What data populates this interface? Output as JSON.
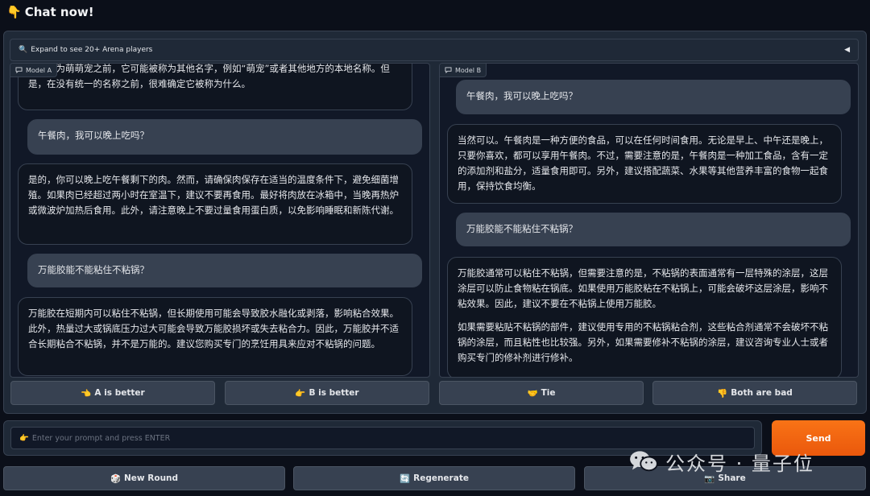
{
  "header": {
    "title": "Chat now!",
    "title_icon": "👇"
  },
  "accordion": {
    "label": "Expand to see 20+ Arena players",
    "icon": "🔍",
    "arrow": "◀"
  },
  "model_a": {
    "label": "Model A",
    "messages": [
      {
        "role": "bot",
        "text": "被命名为萌萌宠之前，它可能被称为其他名字，例如“萌宠”或者其他地方的本地名称。但是，在没有统一的名称之前，很难确定它被称为什么。"
      },
      {
        "role": "user",
        "text": "午餐肉，我可以晚上吃吗？"
      },
      {
        "role": "bot",
        "text": "是的，你可以晚上吃午餐剩下的肉。然而，请确保肉保存在适当的温度条件下，避免细菌增殖。如果肉已经超过两小时在室温下，建议不要再食用。最好将肉放在冰箱中，当晚再热炉或微波炉加热后食用。此外，请注意晚上不要过量食用蛋白质，以免影响睡眠和新陈代谢。"
      },
      {
        "role": "user",
        "text": "万能胶能不能粘住不粘锅？"
      },
      {
        "role": "bot",
        "text": "万能胶在短期内可以粘住不粘锅，但长期使用可能会导致胶水融化或剥落，影响粘合效果。此外，热量过大或锅底压力过大可能会导致万能胶损坏或失去粘合力。因此，万能胶并不适合长期粘合不粘锅，并不是万能的。建议您购买专门的烹饪用具来应对不粘锅的问题。"
      }
    ]
  },
  "model_b": {
    "label": "Model B",
    "messages": [
      {
        "role": "user",
        "text": "午餐肉，我可以晚上吃吗？"
      },
      {
        "role": "bot",
        "text": "当然可以。午餐肉是一种方便的食品，可以在任何时间食用。无论是早上、中午还是晚上，只要你喜欢，都可以享用午餐肉。不过，需要注意的是，午餐肉是一种加工食品，含有一定的添加剂和盐分，适量食用即可。另外，建议搭配蔬菜、水果等其他营养丰富的食物一起食用，保持饮食均衡。"
      },
      {
        "role": "user",
        "text": "万能胶能不能粘住不粘锅？"
      },
      {
        "role": "bot",
        "text": "万能胶通常可以粘住不粘锅，但需要注意的是，不粘锅的表面通常有一层特殊的涂层，这层涂层可以防止食物粘在锅底。如果使用万能胶粘在不粘锅上，可能会破坏这层涂层，影响不粘效果。因此，建议不要在不粘锅上使用万能胶。",
        "text2": "如果需要粘贴不粘锅的部件，建议使用专用的不粘锅粘合剂，这些粘合剂通常不会破坏不粘锅的涂层，而且粘性也比较强。另外，如果需要修补不粘锅的涂层，建议咨询专业人士或者购买专门的修补剂进行修补。"
      }
    ]
  },
  "votes": {
    "a_better": {
      "icon": "👈",
      "label": "A is better"
    },
    "b_better": {
      "icon": "👉",
      "label": "B is better"
    },
    "tie": {
      "icon": "🤝",
      "label": "Tie"
    },
    "both_bad": {
      "icon": "👎",
      "label": "Both are bad"
    }
  },
  "input": {
    "icon": "👉",
    "placeholder": "Enter your prompt and press ENTER"
  },
  "send": {
    "label": "Send"
  },
  "bottom": {
    "new_round": {
      "icon": "🎲",
      "label": "New Round"
    },
    "regenerate": {
      "icon": "🔄",
      "label": "Regenerate"
    },
    "share": {
      "icon": "📷",
      "label": "Share"
    }
  },
  "watermark": {
    "text": "公众号 · 量子位"
  }
}
